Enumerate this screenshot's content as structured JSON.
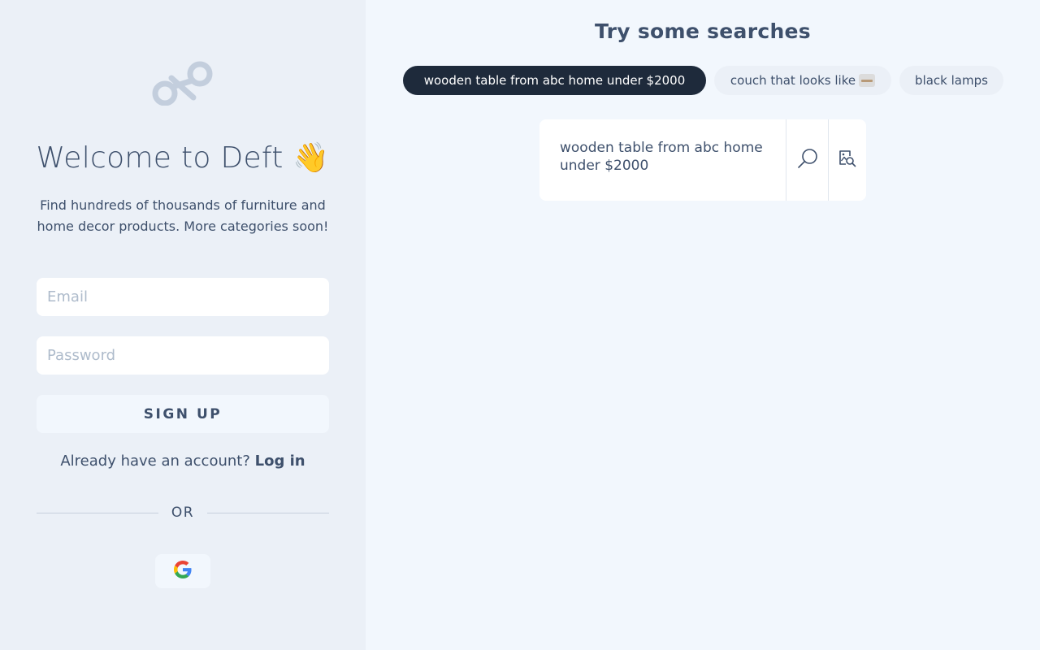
{
  "left": {
    "logo_icon": "deft-infinity-logo",
    "welcome_title": "Welcome to Deft 👋",
    "subtitle": "Find hundreds of thousands of furniture and home decor products. More categories soon!",
    "email_placeholder": "Email",
    "password_placeholder": "Password",
    "signup_label": "SIGN UP",
    "already_text": "Already have an account?",
    "login_label": "Log in",
    "or_text": "OR",
    "google_icon": "google-icon"
  },
  "right": {
    "title": "Try some searches",
    "chips": [
      {
        "label": "wooden table from abc home under $2000",
        "selected": true
      },
      {
        "label": "couch that looks like",
        "selected": false,
        "thumbnail": "couch-thumbnail-image"
      },
      {
        "label": "black lamps",
        "selected": false
      }
    ],
    "search_text": "wooden table from abc home under $2000",
    "search_icon": "search-icon",
    "image_search_icon": "image-search-icon"
  },
  "colors": {
    "left_bg": "#ebf0f7",
    "right_bg": "#f2f7fd",
    "text": "#3e506c",
    "chip_selected_bg": "#1e2a3b"
  }
}
